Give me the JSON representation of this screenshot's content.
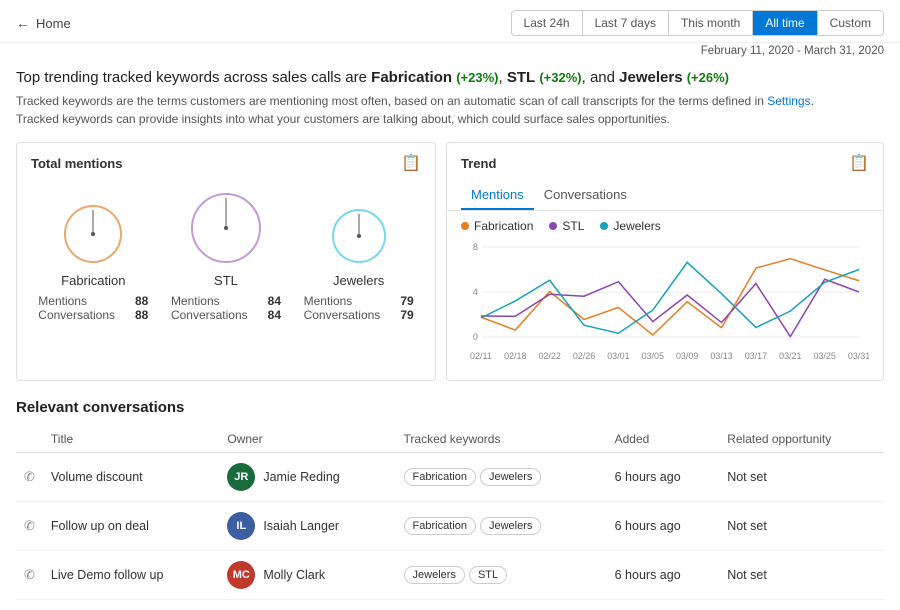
{
  "header": {
    "back_label": "Home",
    "time_filters": [
      "Last 24h",
      "Last 7 days",
      "This month",
      "All time",
      "Custom"
    ],
    "active_filter": "All time"
  },
  "date_range": "February 11, 2020 - March 31, 2020",
  "headline": {
    "prefix": "Top trending tracked keywords across sales calls are ",
    "keyword1": "Fabrication",
    "keyword1_change": "(+23%)",
    "keyword2": "STL",
    "keyword2_change": "(+32%)",
    "keyword3": "Jewelers",
    "keyword3_change": "(+26%)"
  },
  "description": {
    "line1": "Tracked keywords are the terms customers are mentioning most often, based on an automatic scan of call transcripts for the terms defined in ",
    "settings_link": "Settings",
    "line2": ".",
    "line3": "Tracked keywords can provide insights into what your customers are talking about, which could surface sales opportunities."
  },
  "total_mentions": {
    "title": "Total mentions",
    "items": [
      {
        "label": "Fabrication",
        "color": "#e67e22",
        "circle_color": "#e8a96a",
        "mentions": 88,
        "conversations": 88
      },
      {
        "label": "STL",
        "color": "#8e44ad",
        "circle_color": "#c39bd3",
        "mentions": 84,
        "conversations": 84
      },
      {
        "label": "Jewelers",
        "color": "#17a2b8",
        "circle_color": "#76d7ea",
        "mentions": 79,
        "conversations": 79
      }
    ],
    "stat_labels": {
      "mentions": "Mentions",
      "conversations": "Conversations"
    }
  },
  "trend": {
    "title": "Trend",
    "tabs": [
      "Mentions",
      "Conversations"
    ],
    "active_tab": "Mentions",
    "legend": [
      {
        "label": "Fabrication",
        "color": "#e67e22"
      },
      {
        "label": "STL",
        "color": "#8e44ad"
      },
      {
        "label": "Jewelers",
        "color": "#17a2b8"
      }
    ],
    "y_axis": [
      8,
      4,
      0
    ],
    "x_labels": [
      "02/11",
      "02/18",
      "02/22",
      "02/26",
      "03/01",
      "03/05",
      "03/09",
      "03/13",
      "03/17",
      "03/21",
      "03/25",
      "03/31"
    ]
  },
  "conversations": {
    "title": "Relevant conversations",
    "columns": [
      "Title",
      "Owner",
      "Tracked keywords",
      "Added",
      "Related opportunity"
    ],
    "rows": [
      {
        "title": "Volume discount",
        "owner_name": "Jamie Reding",
        "owner_initials": "JR",
        "owner_color": "#1a6b3c",
        "keywords": [
          "Fabrication",
          "Jewelers"
        ],
        "added": "6 hours ago",
        "opportunity": "Not set"
      },
      {
        "title": "Follow up on deal",
        "owner_name": "Isaiah Langer",
        "owner_initials": "IL",
        "owner_color": "#3b5fa0",
        "keywords": [
          "Fabrication",
          "Jewelers"
        ],
        "added": "6 hours ago",
        "opportunity": "Not set"
      },
      {
        "title": "Live Demo follow up",
        "owner_name": "Molly Clark",
        "owner_initials": "MC",
        "owner_color": "#c0392b",
        "keywords": [
          "Jewelers",
          "STL"
        ],
        "added": "6 hours ago",
        "opportunity": "Not set"
      }
    ]
  }
}
